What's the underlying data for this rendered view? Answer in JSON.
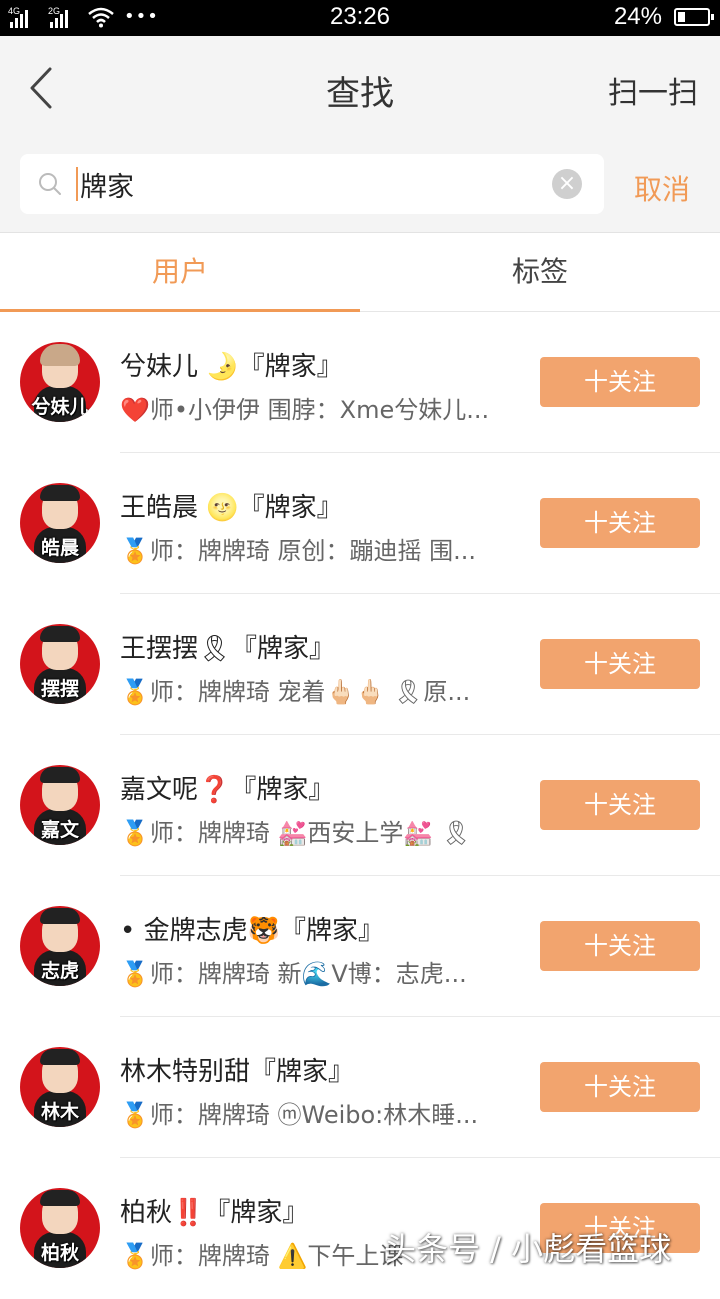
{
  "status_bar": {
    "net1": "4G",
    "net2": "2G",
    "more": "•••",
    "time": "23:26",
    "battery": "24%",
    "battery_level": 0.24
  },
  "header": {
    "title": "查找",
    "scan": "扫一扫",
    "search_value": "牌家",
    "cancel": "取消",
    "clear_icon": "clear-icon"
  },
  "tabs": [
    {
      "label": "用户",
      "active": true
    },
    {
      "label": "标签",
      "active": false
    }
  ],
  "accent_color": "#f19a56",
  "follow_button_color": "#f2a46e",
  "avatar_color": "#d3141b",
  "users": [
    {
      "name": "兮妹儿 🌛『牌家』",
      "desc": "❤️师•小伊伊 围脖：Xme兮妹儿...",
      "avatar_text": "兮妹儿",
      "follow": "十关注"
    },
    {
      "name": "王皓晨 🌝『牌家』",
      "desc": "🏅师：牌牌琦 原创：蹦迪摇 围...",
      "avatar_text": "皓晨",
      "follow": "十关注"
    },
    {
      "name": "王摆摆🎗『牌家』",
      "desc": "🏅师：牌牌琦 宠着🖕🏻🖕🏻 🎗原...",
      "avatar_text": "摆摆",
      "follow": "十关注"
    },
    {
      "name": "嘉文呢❓『牌家』",
      "desc": "🏅师：牌牌琦 💒西安上学💒 🎗",
      "avatar_text": "嘉文",
      "follow": "十关注"
    },
    {
      "name": "• 金牌志虎🐯『牌家』",
      "desc": "🏅师：牌牌琦 新🌊V博：志虎...",
      "avatar_text": "志虎",
      "follow": "十关注"
    },
    {
      "name": "林木特别甜『牌家』",
      "desc": "🏅师：牌牌琦 ⓜWeibo:林木睡...",
      "avatar_text": "林木",
      "follow": "十关注"
    },
    {
      "name": "柏秋‼️『牌家』",
      "desc": "🏅师：牌牌琦 ⚠️下午上课",
      "avatar_text": "柏秋",
      "follow": "十关注"
    }
  ],
  "watermark": "头条号 / 小彪看篮球"
}
